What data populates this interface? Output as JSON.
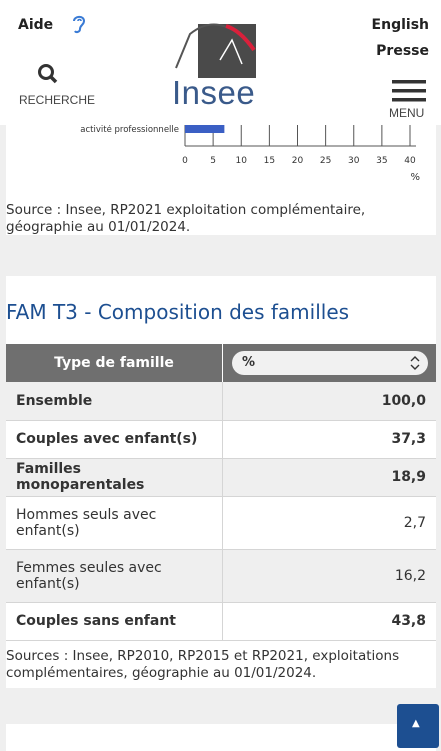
{
  "header": {
    "aide": "Aide",
    "search_label": "RECHERCHE",
    "english": "English",
    "presse": "Presse",
    "menu_label": "MENU",
    "logo_text": "Insee"
  },
  "chart_data": {
    "type": "bar",
    "orientation": "horizontal",
    "categories": [
      "activité professionnelle"
    ],
    "values": [
      7
    ],
    "xlabel": "%",
    "xticks": [
      "0",
      "5",
      "10",
      "15",
      "20",
      "25",
      "30",
      "35",
      "40"
    ],
    "xlim": [
      0,
      40
    ],
    "color": "#3b5fc4"
  },
  "chart_source": "Source : Insee, RP2021 exploitation complémentaire, géographie au 01/01/2024.",
  "table": {
    "title": "FAM T3 - Composition des familles",
    "col_header": "Type de famille",
    "select_value": "%",
    "rows": [
      {
        "label": "Ensemble",
        "value": "100,0",
        "bold": true,
        "shaded": true
      },
      {
        "label": "Couples avec enfant(s)",
        "value": "37,3",
        "bold": true,
        "shaded": false
      },
      {
        "label": "Familles monoparentales",
        "value": "18,9",
        "bold": true,
        "shaded": true
      },
      {
        "label": " Hommes seuls avec enfant(s)",
        "value": "2,7",
        "bold": false,
        "shaded": false
      },
      {
        "label": " Femmes seules avec enfant(s)",
        "value": "16,2",
        "bold": false,
        "shaded": true
      },
      {
        "label": "Couples sans enfant",
        "value": "43,8",
        "bold": true,
        "shaded": false
      }
    ],
    "source": "Sources : Insee, RP2010, RP2015 et RP2021, exploitations complémentaires, géographie au 01/01/2024."
  },
  "back_to_top_icon": "caret-up-icon"
}
